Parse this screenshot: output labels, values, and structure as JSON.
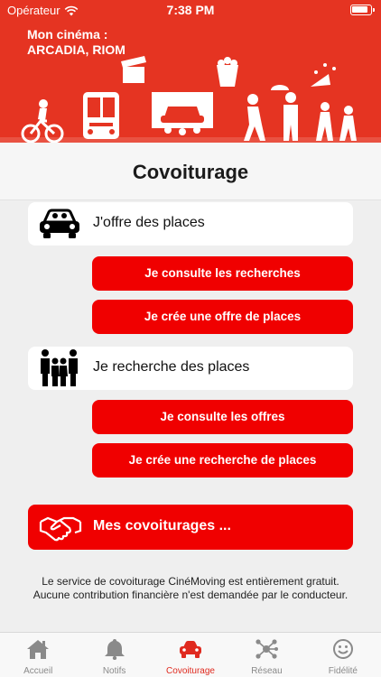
{
  "status_bar": {
    "carrier": "Opérateur",
    "time": "7:38 PM"
  },
  "header": {
    "cinema_label": "Mon cinéma :",
    "cinema_name": "ARCADIA, RIOM",
    "brand_color": "#e53422"
  },
  "page": {
    "title": "Covoiturage"
  },
  "offer_section": {
    "label": "J'offre des places",
    "icon": "car-icon",
    "buttons": [
      "Je consulte les recherches",
      "Je crée une offre de places"
    ]
  },
  "search_section": {
    "label": "Je recherche des places",
    "icon": "family-icon",
    "buttons": [
      "Je consulte les offres",
      "Je crée une recherche de places"
    ]
  },
  "my_carpools": {
    "label": "Mes covoiturages ...",
    "icon": "handshake-icon"
  },
  "footer": {
    "line1": "Le service de covoiturage CinéMoving est entièrement gratuit.",
    "line2": "Aucune contribution financière n'est demandée par le conducteur."
  },
  "tabs": [
    {
      "label": "Accueil",
      "icon": "home-icon",
      "active": false
    },
    {
      "label": "Notifs",
      "icon": "bell-icon",
      "active": false
    },
    {
      "label": "Covoiturage",
      "icon": "car-icon",
      "active": true
    },
    {
      "label": "Réseau",
      "icon": "network-icon",
      "active": false
    },
    {
      "label": "Fidélité",
      "icon": "smiley-icon",
      "active": false
    }
  ],
  "colors": {
    "accent_red": "#f00000",
    "active_tab": "#e02a1f"
  }
}
